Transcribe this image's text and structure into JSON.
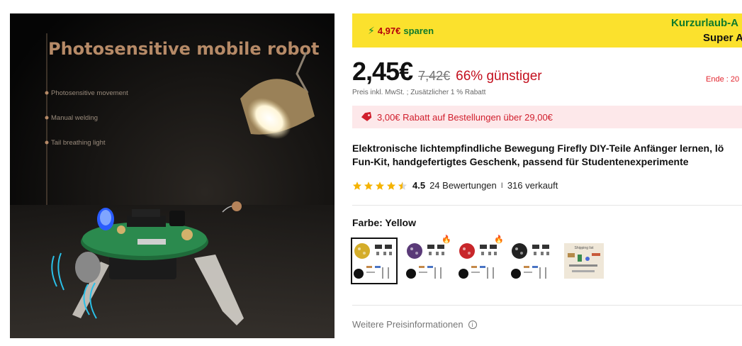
{
  "image": {
    "title": "Photosensitive mobile robot",
    "features": [
      "Photosensitive movement",
      "Manual welding",
      "Tail breathing light"
    ]
  },
  "promo": {
    "save_amount": "4,97€",
    "save_word": "sparen",
    "title": "Kurzurlaub-A",
    "subtitle": "Super A"
  },
  "price": {
    "current": "2,45€",
    "old": "7,42€",
    "discount": "66% günstiger",
    "end_label": "Ende : 20",
    "tax_note": "Preis inkl. MwSt. ; Zusätzlicher 1 % Rabatt"
  },
  "coupon": {
    "text": "3,00€ Rabatt auf Bestellungen über 29,00€"
  },
  "product": {
    "title_line1": "Elektronische lichtempfindliche Bewegung Firefly DIY-Teile Anfänger lernen, lö",
    "title_line2": "Fun-Kit, handgefertigtes Geschenk, passend für Studentenexperimente"
  },
  "rating": {
    "value": "4.5",
    "stars": 4.5,
    "reviews": "24 Bewertungen",
    "separator": "I",
    "sold": "316 verkauft"
  },
  "variant": {
    "label": "Farbe: Yellow",
    "options": [
      {
        "color": "#d4ad2a",
        "selected": true,
        "hot": false
      },
      {
        "color": "#5a3a78",
        "selected": false,
        "hot": true
      },
      {
        "color": "#c8262a",
        "selected": false,
        "hot": true
      },
      {
        "color": "#222222",
        "selected": false,
        "hot": false
      },
      {
        "color": "shipping-list",
        "selected": false,
        "hot": false,
        "caption": "Shipping list"
      }
    ]
  },
  "footer": {
    "more_info": "Weitere Preisinformationen"
  },
  "colors": {
    "promo_bg": "#fbe12d",
    "accent_red": "#c30f1d",
    "promo_green": "#0f7a2b",
    "coupon_bg": "#fde8ea",
    "star": "#f5b301"
  }
}
